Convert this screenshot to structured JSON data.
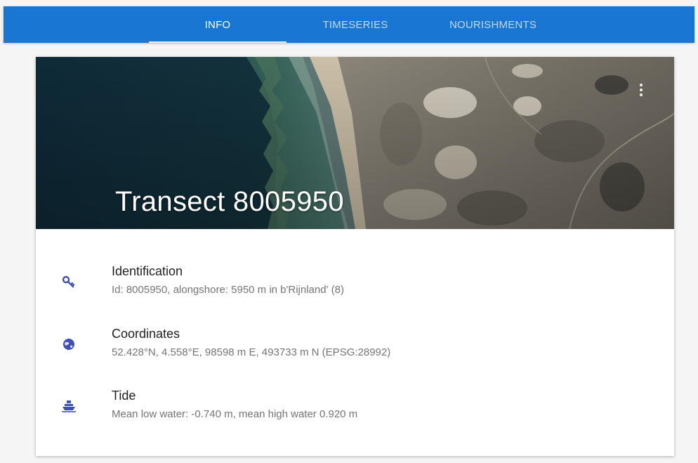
{
  "tabs": [
    {
      "label": "INFO",
      "active": true
    },
    {
      "label": "TIMESERIES",
      "active": false
    },
    {
      "label": "NOURISHMENTS",
      "active": false
    }
  ],
  "hero": {
    "title": "Transect 8005950",
    "menu_icon": "more-vert-icon"
  },
  "details": [
    {
      "icon": "key-icon",
      "title": "Identification",
      "value": "Id: 8005950, alongshore: 5950 m in b'Rijnland' (8)"
    },
    {
      "icon": "globe-icon",
      "title": "Coordinates",
      "value": "52.428°N, 4.558°E, 98598 m E, 493733 m N (EPSG:28992)"
    },
    {
      "icon": "ship-icon",
      "title": "Tide",
      "value": "Mean low water: -0.740 m, mean high water 0.920 m"
    }
  ],
  "colors": {
    "appbar": "#1976d2",
    "icon": "#3f51b5",
    "title_text": "#212121",
    "secondary_text": "#757575"
  }
}
